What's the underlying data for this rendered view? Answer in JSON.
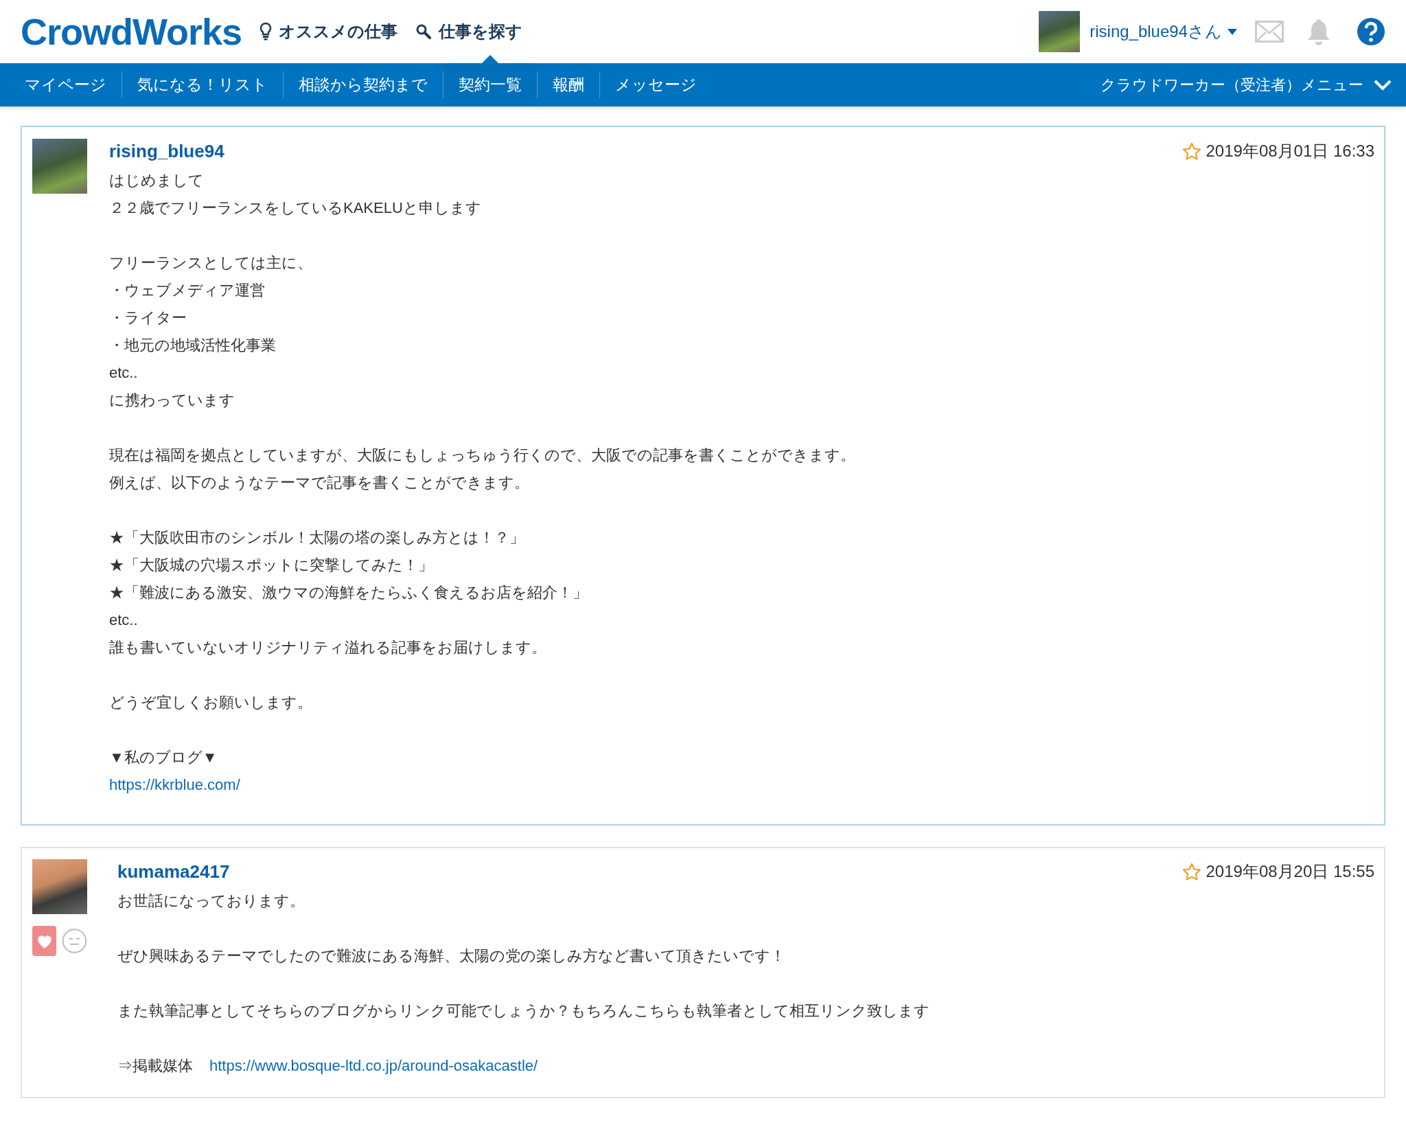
{
  "header": {
    "logo": "CrowdWorks",
    "links": [
      {
        "kind": "bulb",
        "label": "オススメの仕事"
      },
      {
        "kind": "search",
        "label": "仕事を探す"
      }
    ],
    "user": "rising_blue94さん"
  },
  "nav": {
    "tabs": [
      {
        "label": "マイページ",
        "selected": false
      },
      {
        "label": "気になる！リスト",
        "selected": false
      },
      {
        "label": "相談から契約まで",
        "selected": false
      },
      {
        "label": "契約一覧",
        "selected": true
      },
      {
        "label": "報酬",
        "selected": false
      },
      {
        "label": "メッセージ",
        "selected": false
      }
    ],
    "menu": "クラウドワーカー（受注者）メニュー"
  },
  "messages": [
    {
      "author": "rising_blue94",
      "date": "2019年08月01日 16:33",
      "starred": false,
      "highlighted": true,
      "paragraphs": [
        [
          {
            "text": "はじめまして"
          },
          {
            "text": "２２歳でフリーランスをしているKAKELUと申します"
          }
        ],
        [
          {
            "text": "フリーランスとしては主に、"
          },
          {
            "text": "・ウェブメディア運営"
          },
          {
            "text": "・ライター"
          },
          {
            "text": "・地元の地域活性化事業"
          },
          {
            "text": "etc.."
          },
          {
            "text": "に携わっています"
          }
        ],
        [
          {
            "text": "現在は福岡を拠点としていますが、大阪にもしょっちゅう行くので、大阪での記事を書くことができます。"
          },
          {
            "text": "例えば、以下のようなテーマで記事を書くことができます。"
          }
        ],
        [
          {
            "text": "★「大阪吹田市のシンボル！太陽の塔の楽しみ方とは！？」"
          },
          {
            "text": "★「大阪城の穴場スポットに突撃してみた！」"
          },
          {
            "text": "★「難波にある激安、激ウマの海鮮をたらふく食えるお店を紹介！」"
          },
          {
            "text": "etc.."
          },
          {
            "text": "誰も書いていないオリジナリティ溢れる記事をお届けします。"
          }
        ],
        [
          {
            "text": "どうぞ宜しくお願いします。"
          }
        ],
        [
          {
            "text": "▼私のブログ▼"
          },
          {
            "link": "https://kkrblue.com/"
          }
        ]
      ]
    },
    {
      "author": "kumama2417",
      "date": "2019年08月20日 15:55",
      "starred": false,
      "highlighted": false,
      "paragraphs": [
        [
          {
            "text": "お世話になっております。"
          }
        ],
        [
          {
            "text": "ぜひ興味あるテーマでしたので難波にある海鮮、太陽の党の楽しみ方など書いて頂きたいです！"
          }
        ],
        [
          {
            "text": "また執筆記事としてそちらのブログからリンク可能でしょうか？もちろんこちらも執筆者として相互リンク致します"
          }
        ],
        [
          {
            "text": "⇒掲載媒体",
            "link": "https://www.bosque-ltd.co.jp/around-osakacastle/"
          }
        ]
      ],
      "reactions": [
        {
          "kind": "like",
          "selected": true
        },
        {
          "kind": "neutral",
          "selected": false
        }
      ]
    }
  ]
}
